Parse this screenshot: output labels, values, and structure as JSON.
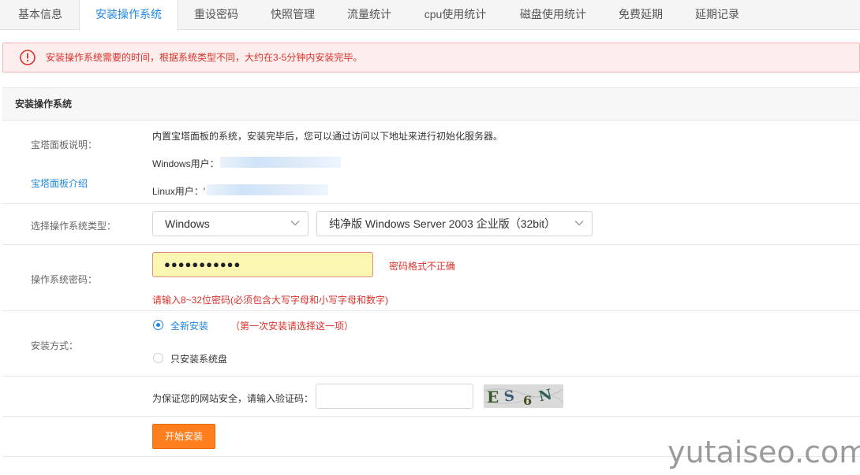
{
  "tabs": [
    {
      "label": "基本信息",
      "active": false
    },
    {
      "label": "安装操作系统",
      "active": true
    },
    {
      "label": "重设密码",
      "active": false
    },
    {
      "label": "快照管理",
      "active": false
    },
    {
      "label": "流量统计",
      "active": false
    },
    {
      "label": "cpu使用统计",
      "active": false
    },
    {
      "label": "磁盘使用统计",
      "active": false
    },
    {
      "label": "免费延期",
      "active": false
    },
    {
      "label": "延期记录",
      "active": false
    }
  ],
  "alert": {
    "icon": "info-circle-icon",
    "text": "安装操作系统需要的时间，根据系统类型不同，大约在3-5分钟内安装完毕。"
  },
  "panel": {
    "title": "安装操作系统"
  },
  "baota": {
    "label": "宝塔面板说明：",
    "description": "内置宝塔面板的系统，安装完毕后，您可以通过访问以下地址来进行初始化服务器。",
    "windows_label": "Windows用户：",
    "linux_label": "Linux用户：'",
    "intro_link": "宝塔面板介绍"
  },
  "os_type": {
    "label": "选择操作系统类型：",
    "os_select": "Windows",
    "version_select": "纯净版 Windows Server 2003 企业版（32bit）"
  },
  "password": {
    "label": "操作系统密码：",
    "value": "●●●●●●●●●●●",
    "error": "密码格式不正确",
    "hint": "请输入8~32位密码(必须包含大写字母和小写字母和数字)"
  },
  "install_mode": {
    "label": "安装方式：",
    "options": [
      {
        "label": "全新安装",
        "note": "（第一次安装请选择这一项）",
        "selected": true
      },
      {
        "label": "只安装系统盘",
        "note": "",
        "selected": false
      }
    ]
  },
  "captcha": {
    "label": "为保证您的网站安全，请输入验证码：",
    "value": "",
    "image_text": "ES6N"
  },
  "submit_label": "开始安装",
  "watermark": "yutaiseo.com",
  "colors": {
    "accent": "#1e87e0",
    "error": "#d9322b",
    "button": "#ff7f1e"
  }
}
